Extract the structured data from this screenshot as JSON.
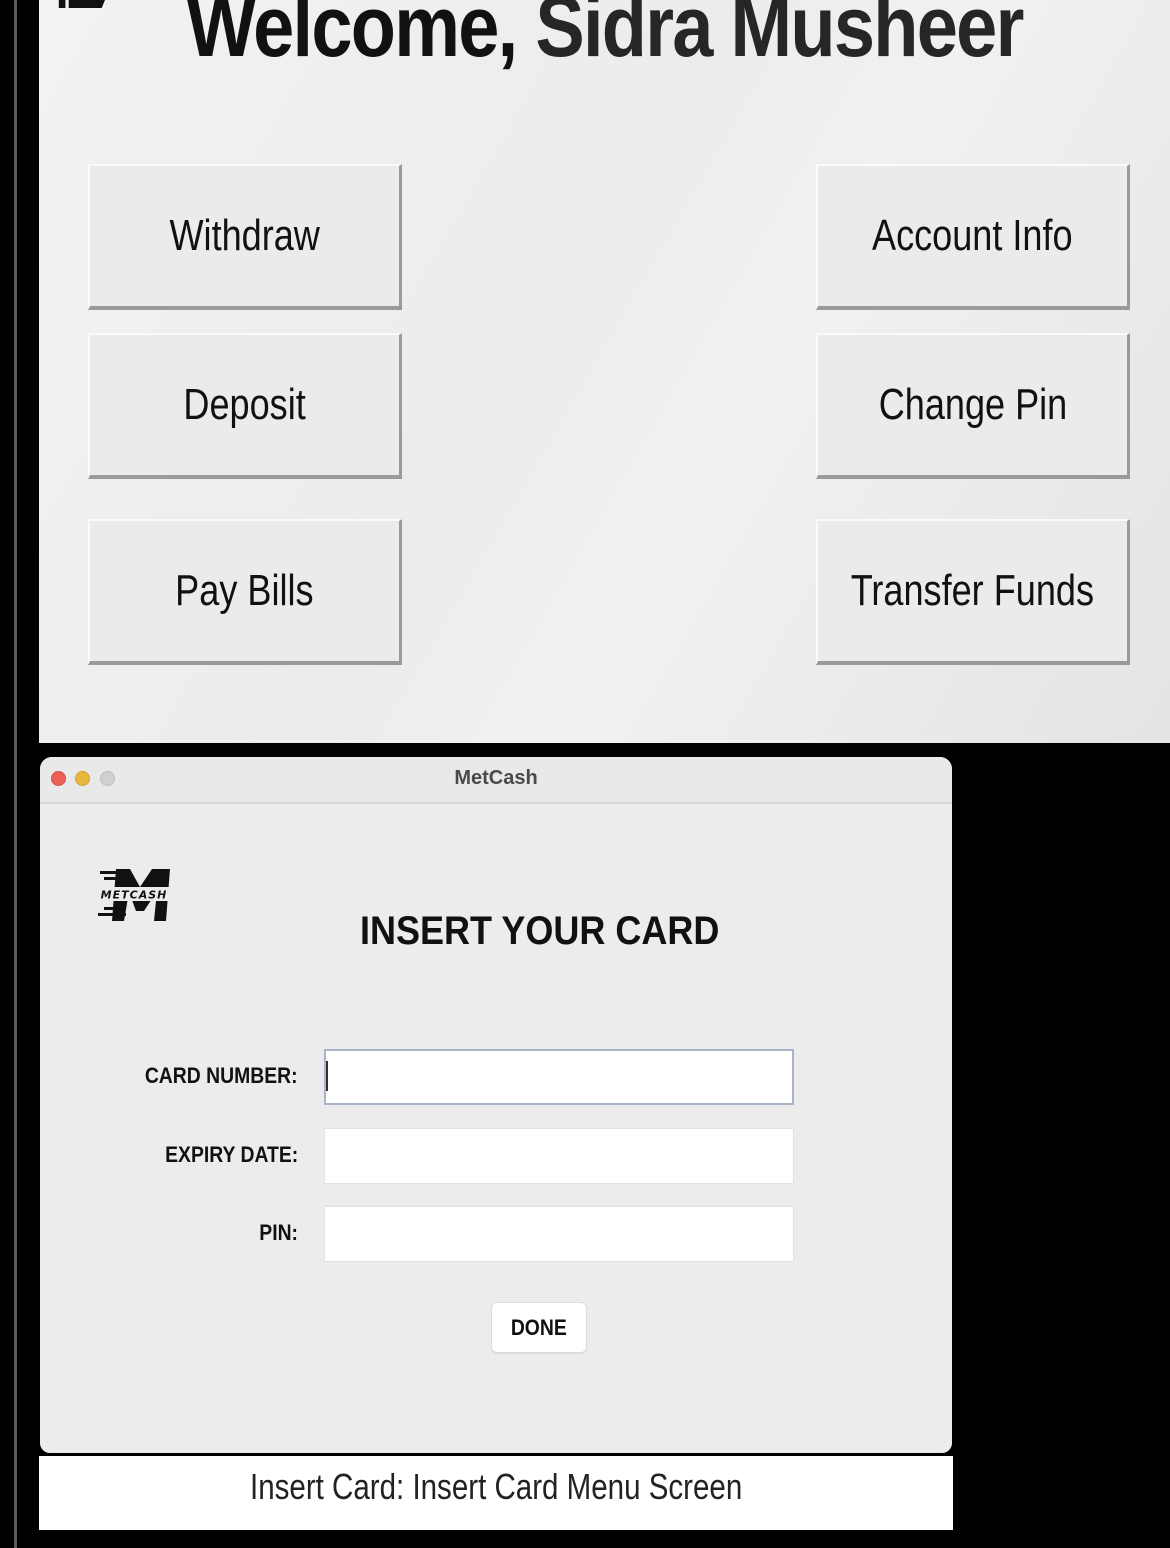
{
  "welcome": {
    "greeting": "Welcome, ",
    "user_name": "Sidra Musheer"
  },
  "menu": {
    "withdraw": "Withdraw",
    "deposit": "Deposit",
    "pay_bills": "Pay Bills",
    "account_info": "Account Info",
    "change_pin": "Change Pin",
    "transfer_funds": "Transfer Funds"
  },
  "window": {
    "title": "MetCash",
    "logo_text": "METCASH",
    "heading": "INSERT YOUR CARD",
    "fields": {
      "card_number_label": "CARD NUMBER:",
      "card_number_value": "",
      "expiry_date_label": "EXPIRY DATE:",
      "expiry_date_value": "",
      "pin_label": "PIN:",
      "pin_value": ""
    },
    "done_label": "DONE"
  },
  "caption": "Insert Card: Insert Card Menu Screen",
  "colors": {
    "close": "#ec5f57",
    "minimize": "#e8b83e",
    "zoom": "#d0d0d0"
  }
}
